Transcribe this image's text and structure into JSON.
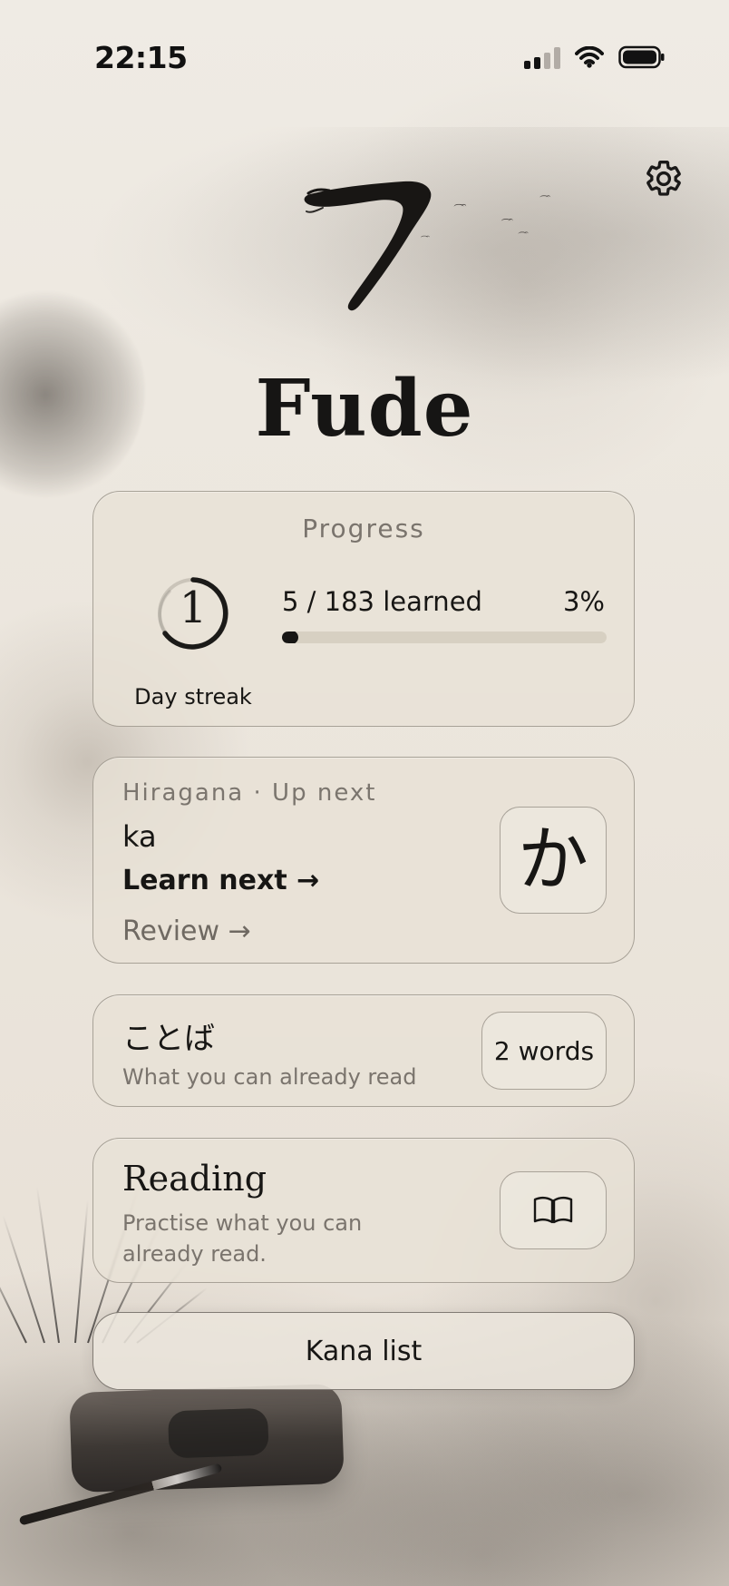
{
  "status_bar": {
    "time": "22:15"
  },
  "brand": {
    "title": "Fude"
  },
  "progress": {
    "heading": "Progress",
    "streak_value": "1",
    "streak_label": "Day streak",
    "learned_text": "5 / 183 learned",
    "percent_text": "3%",
    "fraction": 0.027
  },
  "next_up": {
    "label": "Hiragana · Up next",
    "romaji": "ka",
    "learn_link": "Learn next →",
    "review_link": "Review →",
    "character": "か"
  },
  "words": {
    "title": "ことば",
    "subtitle": "What you can already read",
    "badge": "2 words"
  },
  "reading": {
    "title": "Reading",
    "subtitle": "Practise what you can already read."
  },
  "buttons": {
    "kana_list": "Kana list"
  },
  "icons": {
    "settings": "gear-icon",
    "book": "open-book-icon",
    "signal": "cellular-signal-icon",
    "wifi": "wifi-icon",
    "battery": "battery-icon",
    "logo": "brush-stroke-logo-icon"
  },
  "colors": {
    "background": "#ece6dc",
    "text_primary": "#171614",
    "text_muted": "#7a746d",
    "card_border": "#8f887e",
    "accent_ink": "#171614"
  }
}
